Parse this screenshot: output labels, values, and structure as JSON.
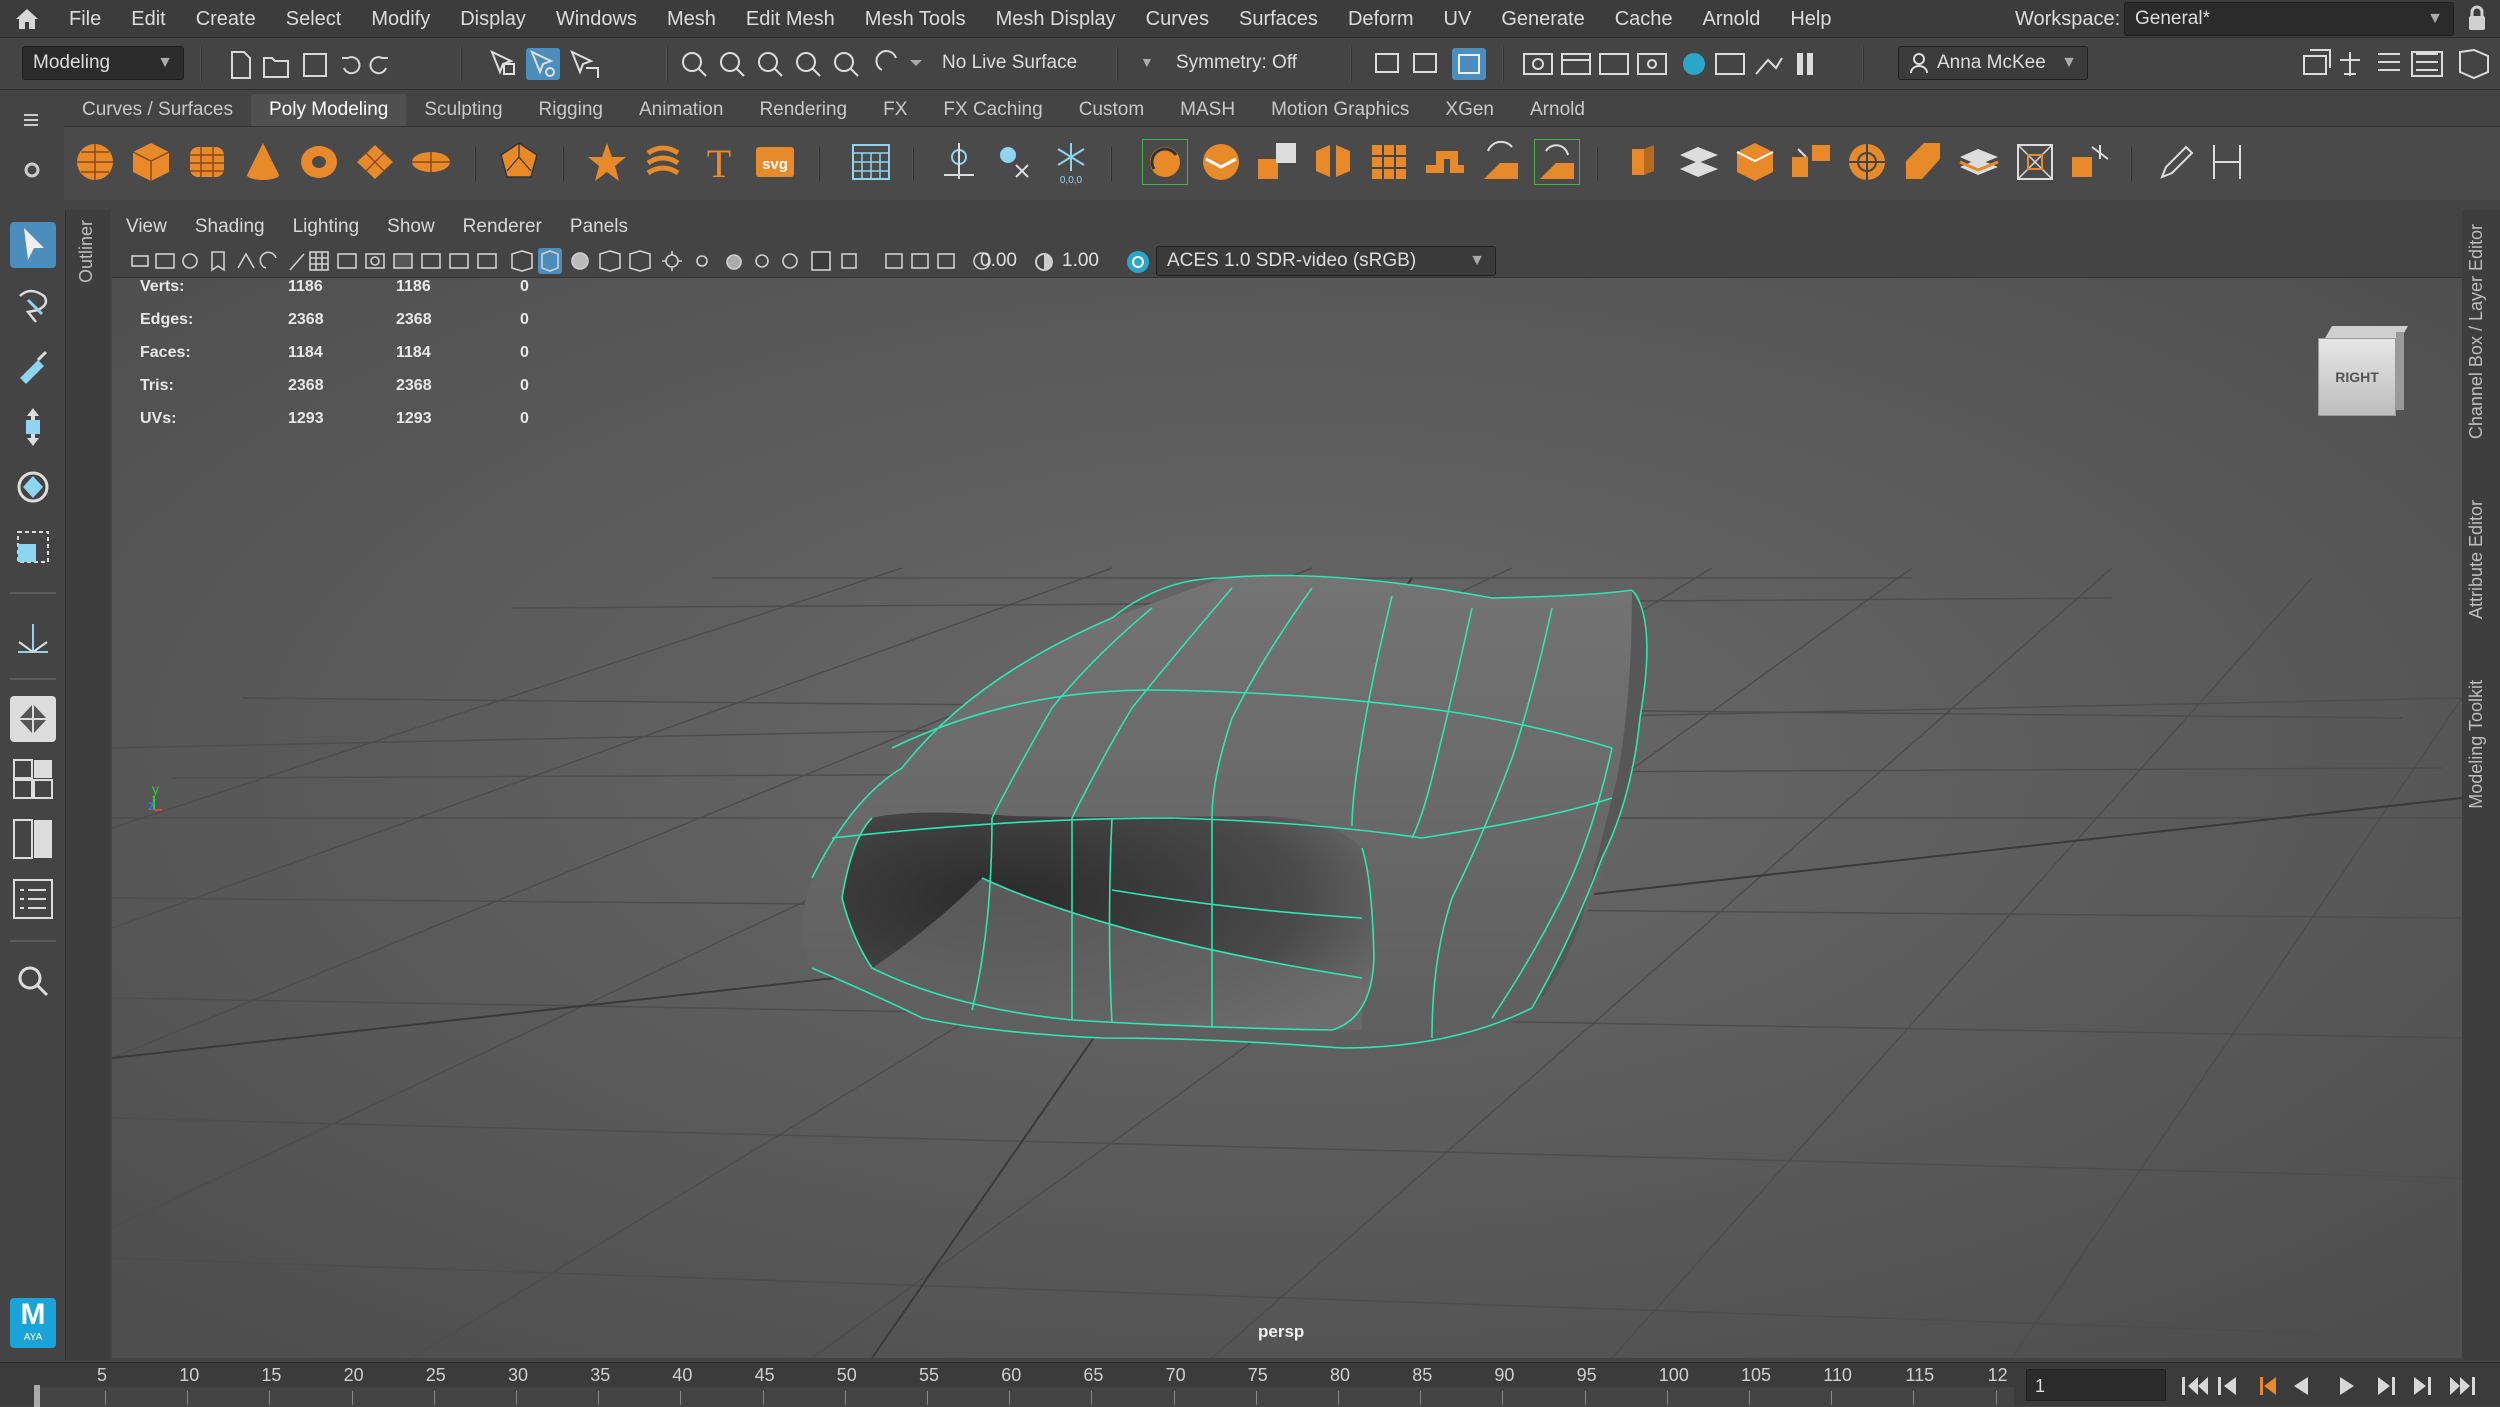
{
  "menubar": {
    "items": [
      "File",
      "Edit",
      "Create",
      "Select",
      "Modify",
      "Display",
      "Windows",
      "Mesh",
      "Edit Mesh",
      "Mesh Tools",
      "Mesh Display",
      "Curves",
      "Surfaces",
      "Deform",
      "UV",
      "Generate",
      "Cache",
      "Arnold",
      "Help"
    ],
    "workspace_label": "Workspace:",
    "workspace_value": "General*"
  },
  "statusline": {
    "mode": "Modeling",
    "live_surface": "No Live Surface",
    "symmetry": "Symmetry: Off",
    "user": "Anna McKee"
  },
  "shelf": {
    "tabs": [
      "Curves / Surfaces",
      "Poly Modeling",
      "Sculpting",
      "Rigging",
      "Animation",
      "Rendering",
      "FX",
      "FX Caching",
      "Custom",
      "MASH",
      "Motion Graphics",
      "XGen",
      "Arnold"
    ],
    "active_tab": "Poly Modeling",
    "svg_label": "svg",
    "text_label": "T"
  },
  "panel": {
    "menus": [
      "View",
      "Shading",
      "Lighting",
      "Show",
      "Renderer",
      "Panels"
    ],
    "exposure": "0.00",
    "gamma": "1.00",
    "colorspace": "ACES 1.0 SDR-video (sRGB)"
  },
  "hud": {
    "rows": [
      {
        "label": "Verts:",
        "a": "1186",
        "b": "1186",
        "c": "0"
      },
      {
        "label": "Edges:",
        "a": "2368",
        "b": "2368",
        "c": "0"
      },
      {
        "label": "Faces:",
        "a": "1184",
        "b": "1184",
        "c": "0"
      },
      {
        "label": "Tris:",
        "a": "2368",
        "b": "2368",
        "c": "0"
      },
      {
        "label": "UVs:",
        "a": "1293",
        "b": "1293",
        "c": "0"
      }
    ]
  },
  "viewport": {
    "camera_label": "persp",
    "viewcube_label": "RIGHT",
    "axis_y": "y",
    "axis_z": "z"
  },
  "dock": {
    "outliner": "Outliner",
    "tabs": [
      "Channel Box / Layer Editor",
      "Attribute Editor",
      "Modeling Toolkit"
    ]
  },
  "timeline": {
    "ticks": [
      "5",
      "10",
      "15",
      "20",
      "25",
      "30",
      "35",
      "40",
      "45",
      "50",
      "55",
      "60",
      "65",
      "70",
      "75",
      "80",
      "85",
      "90",
      "95",
      "100",
      "105",
      "110",
      "115",
      "12"
    ],
    "current_frame": "1"
  },
  "logo": {
    "text": "M",
    "subtext": "AYA"
  },
  "colors": {
    "accent": "#e8892a",
    "selection": "#2ee6b0",
    "active_tool": "#4b8dbd"
  }
}
